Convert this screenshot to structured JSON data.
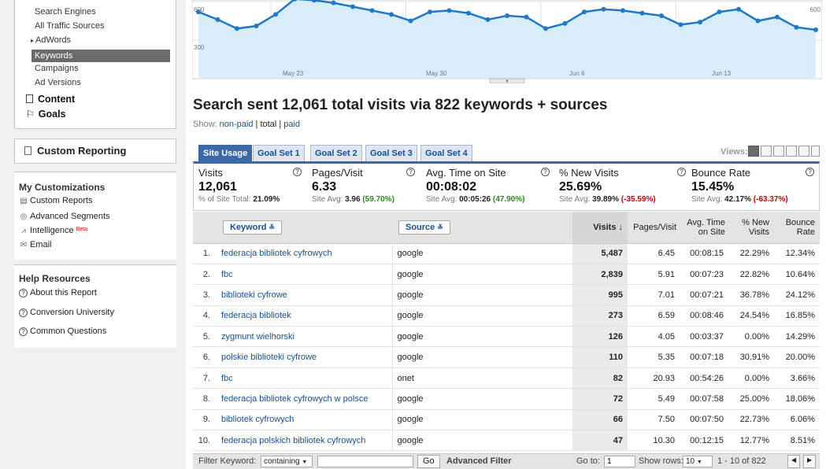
{
  "sidebar": {
    "nav": {
      "sub_items": [
        "Search Engines",
        "All Traffic Sources",
        "AdWords",
        "Keywords",
        "Campaigns",
        "Ad Versions"
      ],
      "adwords_arrow": "▸",
      "content": "Content",
      "goals": "Goals"
    },
    "custom_reporting": "Custom Reporting",
    "my_customizations": {
      "title": "My Customizations",
      "items": [
        "Custom Reports",
        "Advanced Segments",
        "Intelligence",
        "Email"
      ],
      "beta": "Beta"
    },
    "help": {
      "title": "Help Resources",
      "items": [
        "About this Report",
        "Conversion University",
        "Common Questions"
      ]
    }
  },
  "chart": {
    "y_labels": [
      "600",
      "300"
    ],
    "y_right": "600",
    "x_labels": [
      "May 23",
      "May 30",
      "Jun 6",
      "Jun 13"
    ],
    "line_color": "#1f78c8",
    "fill_color": "#d9ecfa"
  },
  "chart_data": {
    "type": "area",
    "title": "",
    "xlabel": "",
    "ylabel": "",
    "ylim": [
      0,
      600
    ],
    "x_ticks": [
      "May 23",
      "May 30",
      "Jun 6",
      "Jun 13"
    ],
    "series": [
      {
        "values": [
          520,
          460,
          390,
          410,
          500,
          620,
          610,
          590,
          560,
          530,
          500,
          450,
          520,
          530,
          510,
          460,
          490,
          480,
          390,
          430,
          520,
          540,
          530,
          510,
          490,
          420,
          440,
          520,
          540,
          450,
          480,
          400,
          380
        ]
      }
    ]
  },
  "heading": "Search sent 12,061 total visits via 822 keywords + sources",
  "show": {
    "label": "Show:",
    "non_paid": "non-paid",
    "sep1": "|",
    "total": "total",
    "sep2": "|",
    "paid": "paid"
  },
  "tabs": [
    "Site Usage",
    "Goal Set 1",
    "Goal Set 2",
    "Goal Set 3",
    "Goal Set 4"
  ],
  "views_label": "Views:",
  "summary": [
    {
      "name": "Visits",
      "value": "12,061",
      "sub_label": "% of Site Total:",
      "sub_value": "21.09%",
      "delta": ""
    },
    {
      "name": "Pages/Visit",
      "value": "6.33",
      "sub_label": "Site Avg:",
      "sub_value": "3.96",
      "delta": "(59.70%)"
    },
    {
      "name": "Avg. Time on Site",
      "value": "00:08:02",
      "sub_label": "Site Avg:",
      "sub_value": "00:05:26",
      "delta": "(47.90%)"
    },
    {
      "name": "% New Visits",
      "value": "25.69%",
      "sub_label": "Site Avg:",
      "sub_value": "39.89%",
      "delta": "(-35.59%)"
    },
    {
      "name": "Bounce Rate",
      "value": "15.45%",
      "sub_label": "Site Avg:",
      "sub_value": "42.17%",
      "delta": "(-63.37%)"
    }
  ],
  "table": {
    "headers": {
      "keyword": "Keyword",
      "source": "Source",
      "visits": "Visits",
      "sort_arrow": "↓",
      "pages_visit": "Pages/Visit",
      "avg_time": "Avg. Time on Site",
      "new_visits": "% New Visits",
      "bounce": "Bounce Rate"
    },
    "rows": [
      {
        "idx": "1.",
        "keyword": "federacja bibliotek cyfrowych",
        "source": "google",
        "visits": "5,487",
        "ppv": "6.45",
        "time": "00:08:15",
        "new": "22.29%",
        "bounce": "12.34%"
      },
      {
        "idx": "2.",
        "keyword": "fbc",
        "source": "google",
        "visits": "2,839",
        "ppv": "5.91",
        "time": "00:07:23",
        "new": "22.82%",
        "bounce": "10.64%"
      },
      {
        "idx": "3.",
        "keyword": "biblioteki cyfrowe",
        "source": "google",
        "visits": "995",
        "ppv": "7.01",
        "time": "00:07:21",
        "new": "36.78%",
        "bounce": "24.12%"
      },
      {
        "idx": "4.",
        "keyword": "federacja bibliotek",
        "source": "google",
        "visits": "273",
        "ppv": "6.59",
        "time": "00:08:46",
        "new": "24.54%",
        "bounce": "16.85%"
      },
      {
        "idx": "5.",
        "keyword": "zygmunt wielhorski",
        "source": "google",
        "visits": "126",
        "ppv": "4.05",
        "time": "00:03:37",
        "new": "0.00%",
        "bounce": "14.29%"
      },
      {
        "idx": "6.",
        "keyword": "polskie biblioteki cyfrowe",
        "source": "google",
        "visits": "110",
        "ppv": "5.35",
        "time": "00:07:18",
        "new": "30.91%",
        "bounce": "20.00%"
      },
      {
        "idx": "7.",
        "keyword": "fbc",
        "source": "onet",
        "visits": "82",
        "ppv": "20.93",
        "time": "00:54:26",
        "new": "0.00%",
        "bounce": "3.66%"
      },
      {
        "idx": "8.",
        "keyword": "federacja bibliotek cyfrowych w polsce",
        "source": "google",
        "visits": "72",
        "ppv": "5.49",
        "time": "00:07:58",
        "new": "25.00%",
        "bounce": "18.06%"
      },
      {
        "idx": "9.",
        "keyword": "bibliotek cyfrowych",
        "source": "google",
        "visits": "66",
        "ppv": "7.50",
        "time": "00:07:50",
        "new": "22.73%",
        "bounce": "6.06%"
      },
      {
        "idx": "10.",
        "keyword": "federacja polskich bibliotek cyfrowych",
        "source": "google",
        "visits": "47",
        "ppv": "10.30",
        "time": "00:12:15",
        "new": "12.77%",
        "bounce": "8.51%"
      }
    ]
  },
  "footer": {
    "filter_label": "Filter Keyword:",
    "filter_mode": "containing",
    "filter_value": "",
    "go": "Go",
    "advanced": "Advanced Filter",
    "goto_label": "Go to:",
    "goto_value": "1",
    "show_rows_label": "Show rows:",
    "show_rows_value": "10",
    "range": "1 - 10 of 822"
  },
  "colors": {
    "tab_active": "#3b69a8",
    "link": "#1a4f91",
    "positive": "#2a8a1a",
    "negative": "#cc0000"
  }
}
